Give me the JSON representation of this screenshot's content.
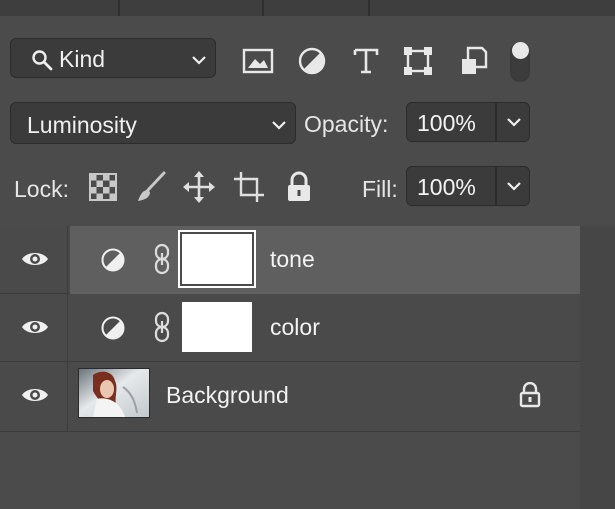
{
  "filter": {
    "kind_label": "Kind",
    "filter_icons": [
      "image-icon",
      "adjustment-icon",
      "type-icon",
      "shape-icon",
      "smart-object-icon"
    ],
    "toggle_state": "on"
  },
  "blend": {
    "mode": "Luminosity",
    "opacity_label": "Opacity:",
    "opacity_value": "100%"
  },
  "lock": {
    "label": "Lock:",
    "icons": [
      "lock-transparent-pixels-icon",
      "lock-image-pixels-icon",
      "lock-position-icon",
      "prevent-autonest-icon",
      "lock-all-icon"
    ],
    "fill_label": "Fill:",
    "fill_value": "100%"
  },
  "layers": [
    {
      "name": "tone",
      "type": "adjustment",
      "selected": true,
      "visible": true
    },
    {
      "name": "color",
      "type": "adjustment",
      "selected": false,
      "visible": true
    },
    {
      "name": "Background",
      "type": "image",
      "selected": false,
      "visible": true,
      "locked": true
    }
  ],
  "colors": {
    "panel_bg": "#4b4b4b",
    "field_bg": "#3b3b3b",
    "selected_row": "#5f5f5f",
    "text": "#e6e6e6"
  }
}
